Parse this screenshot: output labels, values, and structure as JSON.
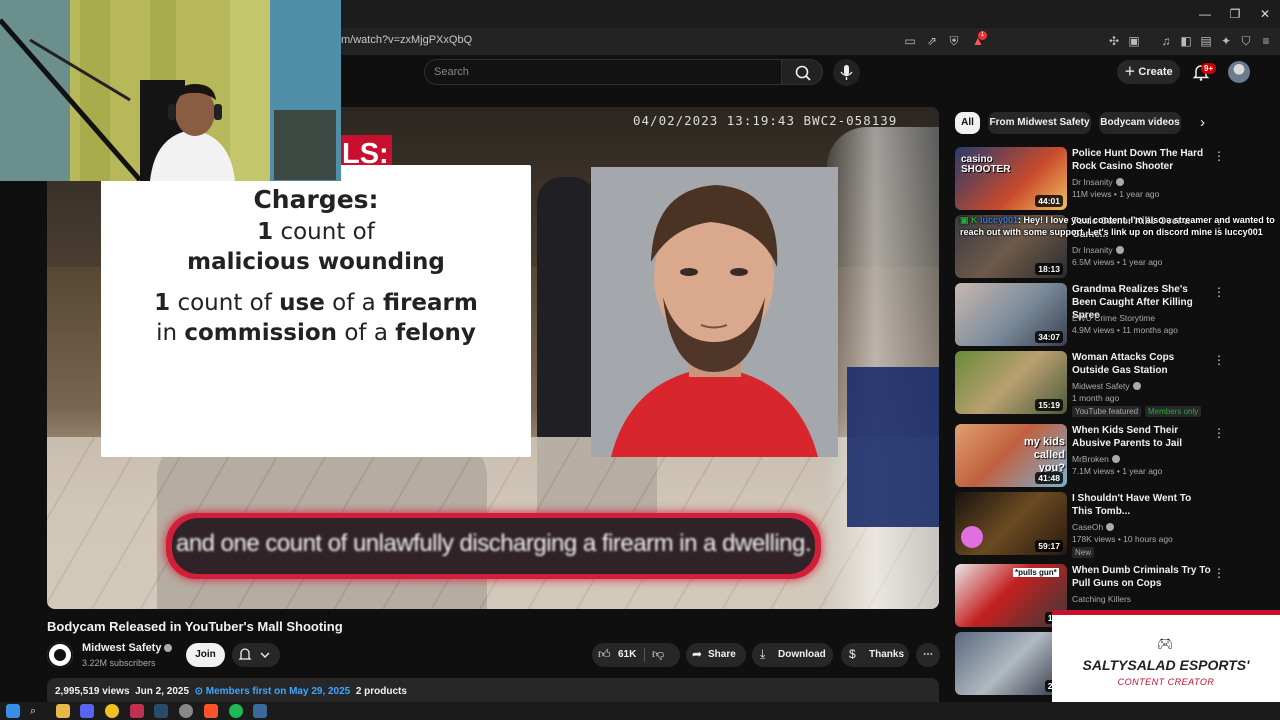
{
  "browser": {
    "url": "m/watch?v=zxMjgPXxQbQ",
    "window_controls": [
      "—",
      "❐",
      "✕"
    ],
    "extension_badge": "1"
  },
  "header": {
    "search_placeholder": "Search",
    "create_label": "Create",
    "notifications_badge": "9+"
  },
  "player": {
    "timestamp": "04/02/2023 13:19:43 BWC2-058139",
    "overlay_tag": "LS:",
    "charges_title": "Charges:",
    "charge1_count": "1",
    "charge1_text": "count of",
    "charge1_crime": "malicious wounding",
    "charge2_count": "1",
    "charge2_a": "count of",
    "charge2_b": "use",
    "charge2_c": "of a",
    "charge2_d": "firearm",
    "charge2_e": "in",
    "charge2_f": "commission",
    "charge2_g": "of a",
    "charge2_h": "felony",
    "caption": "and one count of unlawfully discharging a firearm in a dwelling."
  },
  "video": {
    "title": "Bodycam Released in YouTuber's Mall Shooting",
    "channel": "Midwest Safety",
    "subscribers": "3.22M subscribers",
    "join_label": "Join",
    "likes": "61K",
    "share_label": "Share",
    "download_label": "Download",
    "thanks_label": "Thanks",
    "views": "2,995,519 views",
    "date": "Jun 2, 2025",
    "members_first": "Members first on May 29, 2025",
    "products": "2 products"
  },
  "chips": [
    "All",
    "From Midwest Safety",
    "Bodycam videos"
  ],
  "recommendations": [
    {
      "title": "Police Hunt Down The Hard Rock Casino Shooter",
      "channel": "Dr Insanity",
      "meta": "11M views • 1 year ago",
      "duration": "44:01",
      "thumb_text": "casino SHOOTER",
      "verified": true
    },
    {
      "title": "Toxic Gamer Kills Over a Game...",
      "channel": "Dr Insanity",
      "meta": "6.5M views • 1 year ago",
      "duration": "18:13",
      "thumb_text": "",
      "verified": true
    },
    {
      "title": "Grandma Realizes She's Been Caught After Killing Spree",
      "channel": "EWU Crime Storytime",
      "meta": "4.9M views • 11 months ago",
      "duration": "34:07",
      "thumb_text": "",
      "verified": false
    },
    {
      "title": "Woman Attacks Cops Outside Gas Station",
      "channel": "Midwest Safety",
      "meta": "1 month ago",
      "duration": "15:19",
      "thumb_text": "",
      "verified": true,
      "badges": [
        "YouTube featured",
        "Members only"
      ]
    },
    {
      "title": "When Kids Send Their Abusive Parents to Jail",
      "channel": "MrBroken",
      "meta": "7.1M views • 1 year ago",
      "duration": "41:48",
      "thumb_text": "my kids called you?",
      "verified": true
    },
    {
      "title": "I Shouldn't Have Went To This Tomb...",
      "channel": "CaseOh",
      "meta": "178K views • 10 hours ago",
      "duration": "59:17",
      "thumb_text": "",
      "verified": true,
      "badges": [
        "New"
      ]
    },
    {
      "title": "When Dumb Criminals Try To Pull Guns on Cops",
      "channel": "Catching Killers",
      "meta": "",
      "duration": "19:",
      "thumb_text": "*pulls gun*",
      "verified": false
    },
    {
      "title": "",
      "channel": "",
      "meta": "",
      "duration": "26:",
      "thumb_text": "",
      "verified": false
    }
  ],
  "chat": {
    "username": "luccy001",
    "message": ": Hey! I love your content. I'm also a streamer and wanted to reach out with some support. Let's link up on discord mine is luccy001"
  },
  "brand": {
    "name": "SALTYSALAD ESPORTS'",
    "subtitle": "CONTENT CREATOR"
  },
  "colors": {
    "accent_red": "#c8102e",
    "link_blue": "#3ea6ff",
    "bg": "#0f0f0f"
  }
}
